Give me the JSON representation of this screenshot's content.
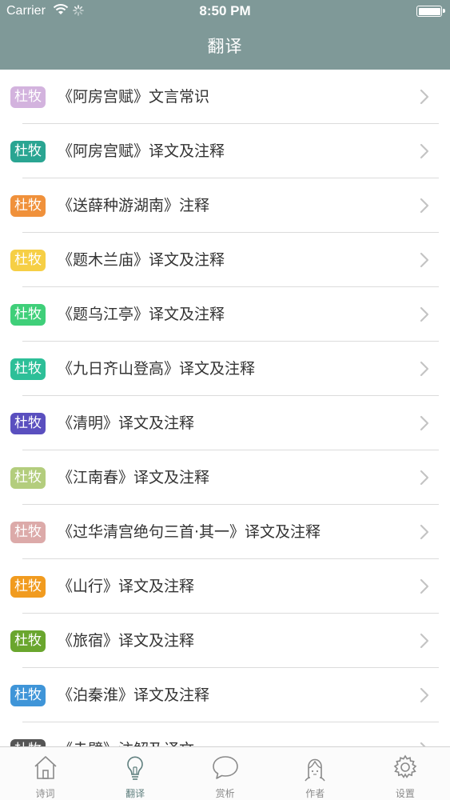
{
  "status_bar": {
    "carrier": "Carrier",
    "time": "8:50 PM"
  },
  "nav": {
    "title": "翻译"
  },
  "list": {
    "items": [
      {
        "badge": "杜牧",
        "color": "#d3b3de",
        "title": "《阿房宫赋》文言常识"
      },
      {
        "badge": "杜牧",
        "color": "#2aa592",
        "title": "《阿房宫赋》译文及注释"
      },
      {
        "badge": "杜牧",
        "color": "#f0913b",
        "title": "《送薛种游湖南》注释"
      },
      {
        "badge": "杜牧",
        "color": "#f6cf45",
        "title": "《题木兰庙》译文及注释"
      },
      {
        "badge": "杜牧",
        "color": "#3fcf79",
        "title": "《题乌江亭》译文及注释"
      },
      {
        "badge": "杜牧",
        "color": "#2dbf98",
        "title": "《九日齐山登高》译文及注释"
      },
      {
        "badge": "杜牧",
        "color": "#5a4fbf",
        "title": "《清明》译文及注释"
      },
      {
        "badge": "杜牧",
        "color": "#b3cd7d",
        "title": "《江南春》译文及注释"
      },
      {
        "badge": "杜牧",
        "color": "#dcaaa9",
        "title": "《过华清宫绝句三首·其一》译文及注释"
      },
      {
        "badge": "杜牧",
        "color": "#f19b1f",
        "title": "《山行》译文及注释"
      },
      {
        "badge": "杜牧",
        "color": "#6aa62e",
        "title": "《旅宿》译文及注释"
      },
      {
        "badge": "杜牧",
        "color": "#3f95d8",
        "title": "《泊秦淮》译文及注释"
      },
      {
        "badge": "杜牧",
        "color": "#555555",
        "title": "《赤壁》注解及译文"
      }
    ]
  },
  "tabs": [
    {
      "label": "诗词",
      "icon": "house-icon",
      "active": false
    },
    {
      "label": "翻译",
      "icon": "lightbulb-icon",
      "active": true
    },
    {
      "label": "赏析",
      "icon": "speech-bubble-icon",
      "active": false
    },
    {
      "label": "作者",
      "icon": "person-head-icon",
      "active": false
    },
    {
      "label": "设置",
      "icon": "gear-icon",
      "active": false
    }
  ],
  "colors": {
    "nav_bg": "#7f9998",
    "tab_active": "#5f7f7e",
    "tab_inactive": "#8a8a8a"
  }
}
